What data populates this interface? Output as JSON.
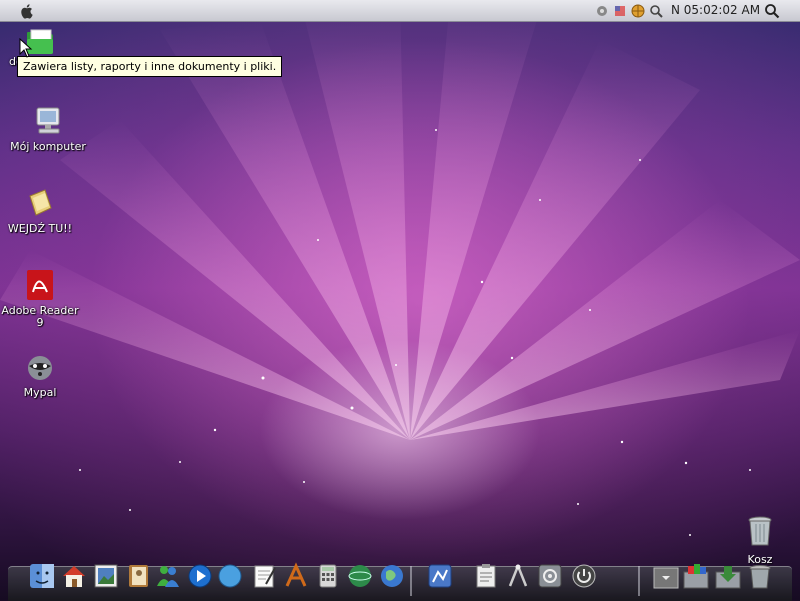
{
  "menubar": {
    "clock": "N 05:02:02 AM"
  },
  "desktop": {
    "icons": [
      {
        "label": "dokumenty"
      },
      {
        "label": "Mój komputer"
      },
      {
        "label": "WEJDŹ TU!!"
      },
      {
        "label": "Adobe Reader\n9"
      },
      {
        "label": "Mypal"
      }
    ],
    "trash_label": "Kosz"
  },
  "tooltip": {
    "text": "Zawiera listy, raporty i inne dokumenty i pliki."
  },
  "colors": {
    "menubar": "#d8d9e0",
    "tooltip_bg": "#ffffe1",
    "wallpaper_pink": "#e878d7"
  }
}
